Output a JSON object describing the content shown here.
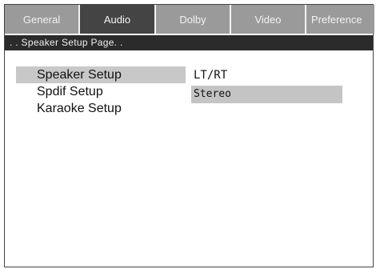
{
  "tabs": [
    {
      "label": "General",
      "active": false
    },
    {
      "label": "Audio",
      "active": true
    },
    {
      "label": "Dolby",
      "active": false
    },
    {
      "label": "Video",
      "active": false
    },
    {
      "label": "Preference",
      "active": false
    }
  ],
  "page_title": ". . Speaker Setup Page. .",
  "menu": {
    "items": [
      {
        "label": "Speaker Setup",
        "selected": true
      },
      {
        "label": "Spdif Setup",
        "selected": false
      },
      {
        "label": "Karaoke Setup",
        "selected": false
      }
    ]
  },
  "options": {
    "current_value": "LT/RT",
    "items": [
      {
        "label": "Stereo",
        "highlighted": true
      }
    ]
  },
  "colors": {
    "tab_bg": "#9a9a9a",
    "tab_active_bg": "#444444",
    "page_bar_bg": "#2b2b2b",
    "highlight": "#c8c8c8"
  }
}
